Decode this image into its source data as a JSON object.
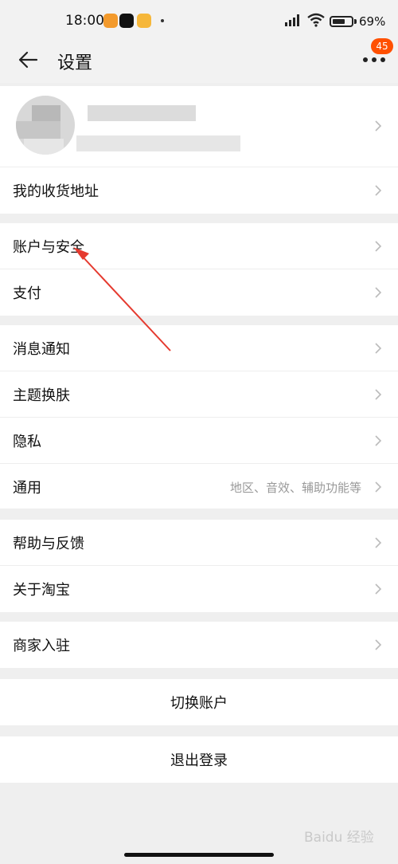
{
  "status_bar": {
    "time": "18:00",
    "battery_text": "69%",
    "battery_level": 0.69
  },
  "header": {
    "title": "设置",
    "back_icon": "arrow-left-icon",
    "more_icon": "more-dots-icon",
    "message_badge": "45"
  },
  "groups": [
    {
      "items": [
        {
          "label": "我的收货地址"
        }
      ]
    },
    {
      "items": [
        {
          "label": "账户与安全"
        },
        {
          "label": "支付"
        }
      ]
    },
    {
      "items": [
        {
          "label": "消息通知"
        },
        {
          "label": "主题换肤"
        },
        {
          "label": "隐私"
        },
        {
          "label": "通用",
          "hint": "地区、音效、辅助功能等"
        }
      ]
    },
    {
      "items": [
        {
          "label": "帮助与反馈"
        },
        {
          "label": "关于淘宝"
        }
      ]
    },
    {
      "items": [
        {
          "label": "商家入驻"
        }
      ]
    }
  ],
  "actions": {
    "switch_account": "切换账户",
    "logout": "退出登录"
  },
  "watermark": "Baidu 经验",
  "colors": {
    "accent": "#ff5000",
    "background": "#efefef",
    "annotation": "#e53a2f"
  }
}
